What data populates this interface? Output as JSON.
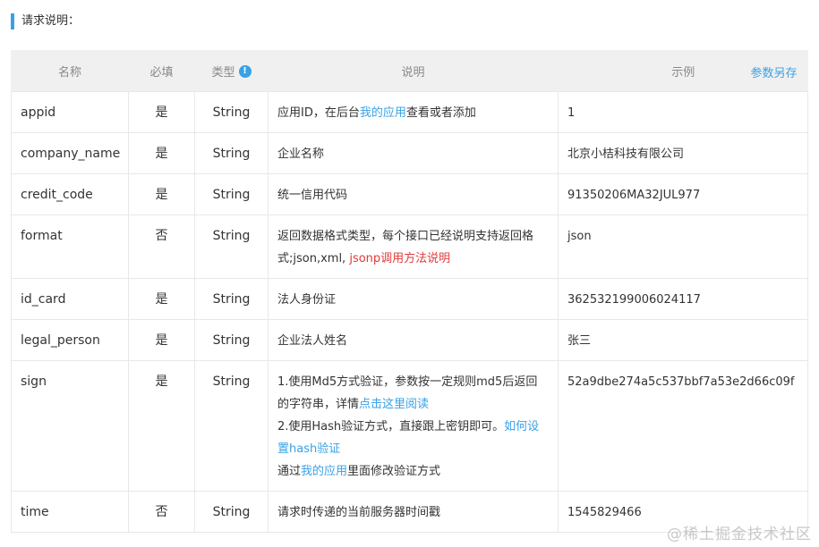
{
  "section_title": "请求说明：",
  "header": {
    "name": "名称",
    "required": "必填",
    "type": "类型",
    "type_info_icon": "info-icon",
    "description": "说明",
    "example": "示例",
    "save_as": "参数另存"
  },
  "rows": [
    {
      "name": "appid",
      "required": "是",
      "type": "String",
      "desc": {
        "p1": "应用ID，在后台",
        "link": "我的应用",
        "p2": "查看或者添加"
      },
      "example": "1"
    },
    {
      "name": "company_name",
      "required": "是",
      "type": "String",
      "desc": {
        "text": "企业名称"
      },
      "example": "北京小桔科技有限公司"
    },
    {
      "name": "credit_code",
      "required": "是",
      "type": "String",
      "desc": {
        "text": "统一信用代码"
      },
      "example": "91350206MA32JUL977"
    },
    {
      "name": "format",
      "required": "否",
      "type": "String",
      "desc": {
        "p1": "返回数据格式类型，每个接口已经说明支持返回格式;json,xml, ",
        "link": "jsonp调用方法说明"
      },
      "example": "json"
    },
    {
      "name": "id_card",
      "required": "是",
      "type": "String",
      "desc": {
        "text": "法人身份证"
      },
      "example": "362532199006024117"
    },
    {
      "name": "legal_person",
      "required": "是",
      "type": "String",
      "desc": {
        "text": "企业法人姓名"
      },
      "example": "张三"
    },
    {
      "name": "sign",
      "required": "是",
      "type": "String",
      "desc": {
        "l1": "1.使用Md5方式验证，参数按一定规则md5后返回的字符串，详情",
        "l1_link": "点击这里阅读",
        "l2": "2.使用Hash验证方式，直接跟上密钥即可。",
        "l2_link": "如何设置hash验证",
        "l3": "通过",
        "l3_link": "我的应用",
        "l3_end": "里面修改验证方式"
      },
      "example": "52a9dbe274a5c537bbf7a53e2d66c09f"
    },
    {
      "name": "time",
      "required": "否",
      "type": "String",
      "desc": {
        "text": "请求时传递的当前服务器时间戳"
      },
      "example": "1545829466"
    }
  ],
  "watermark": "@稀土掘金技术社区",
  "colors": {
    "accent": "#38a1e6",
    "required_yes": "#e03a3a",
    "header_bg": "#f0f0f0"
  }
}
